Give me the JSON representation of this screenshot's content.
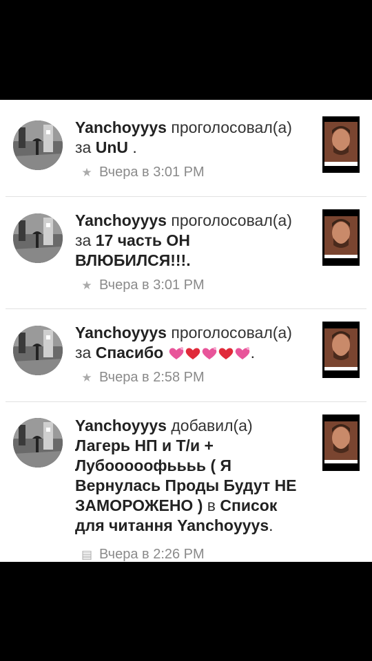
{
  "feed": {
    "items": [
      {
        "user": "Yanchoyyys",
        "verb": "проголосовал(а)",
        "prep": "за",
        "target": "UnU",
        "suffix": " .",
        "time": "Вчера в 3:01 PM",
        "meta_icon": "star-icon"
      },
      {
        "user": "Yanchoyyys",
        "verb": "проголосовал(а)",
        "prep": "за",
        "target": "17 часть ОН ВЛЮБИЛСЯ!!!.",
        "suffix": "",
        "time": "Вчера в 3:01 PM",
        "meta_icon": "star-icon"
      },
      {
        "user": "Yanchoyyys",
        "verb": "проголосовал(а)",
        "prep": "за",
        "target": "Спасибо",
        "suffix": ".",
        "time": "Вчера в 2:58 PM",
        "meta_icon": "star-icon"
      },
      {
        "user": "Yanchoyyys",
        "verb": "добавил(а)",
        "prep": "",
        "target": "Лагерь НП и Т/и + Лубооооофьььь ( Я Вернулась Проды Будут НЕ ЗАМОРОЖЕНО )",
        "mid": " в ",
        "target2": "Список для читання Yanchoyyys",
        "suffix": ".",
        "time": "Вчера в 2:26 PM",
        "meta_icon": "reading-list-icon"
      }
    ]
  },
  "colors": {
    "background": "#ffffff",
    "text": "#222222",
    "meta": "#8a8a8a",
    "heart_pink": "#e8559a",
    "heart_red": "#e02a3a"
  }
}
